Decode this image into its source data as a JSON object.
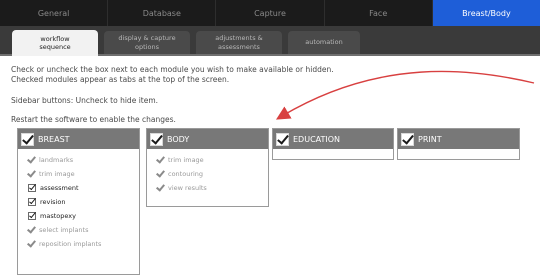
{
  "topnav": {
    "tabs": [
      {
        "label": "General",
        "active": false
      },
      {
        "label": "Database",
        "active": false
      },
      {
        "label": "Capture",
        "active": false
      },
      {
        "label": "Face",
        "active": false
      },
      {
        "label": "Breast/Body",
        "active": true
      }
    ]
  },
  "subtabs": [
    {
      "line1": "workflow",
      "line2": "sequence",
      "active": true
    },
    {
      "line1": "display & capture",
      "line2": "options",
      "active": false
    },
    {
      "line1": "adjustments &",
      "line2": "assessments",
      "active": false
    },
    {
      "line1": "automation",
      "line2": "",
      "active": false
    }
  ],
  "instructions": {
    "line1": "Check or uncheck the box next to each module you wish to make available or hidden.",
    "line2": "Checked modules appear as tabs at the top of the screen.",
    "line3": "Sidebar buttons: Uncheck to hide item.",
    "line4": "Restart the software to enable the changes."
  },
  "modules": {
    "breast": {
      "title": "BREAST",
      "items": [
        {
          "label": "landmarks",
          "style": "tick"
        },
        {
          "label": "trim image",
          "style": "tick"
        },
        {
          "label": "assessment",
          "style": "box"
        },
        {
          "label": "revision",
          "style": "box"
        },
        {
          "label": "mastopexy",
          "style": "box"
        },
        {
          "label": "select implants",
          "style": "tick"
        },
        {
          "label": "reposition implants",
          "style": "tick"
        }
      ]
    },
    "body": {
      "title": "BODY",
      "items": [
        {
          "label": "trim image",
          "style": "tick"
        },
        {
          "label": "contouring",
          "style": "tick"
        },
        {
          "label": "view results",
          "style": "tick"
        }
      ]
    },
    "education": {
      "title": "EDUCATION"
    },
    "print": {
      "title": "PRINT"
    }
  },
  "annotation": {
    "arrow_color": "#d84040"
  }
}
